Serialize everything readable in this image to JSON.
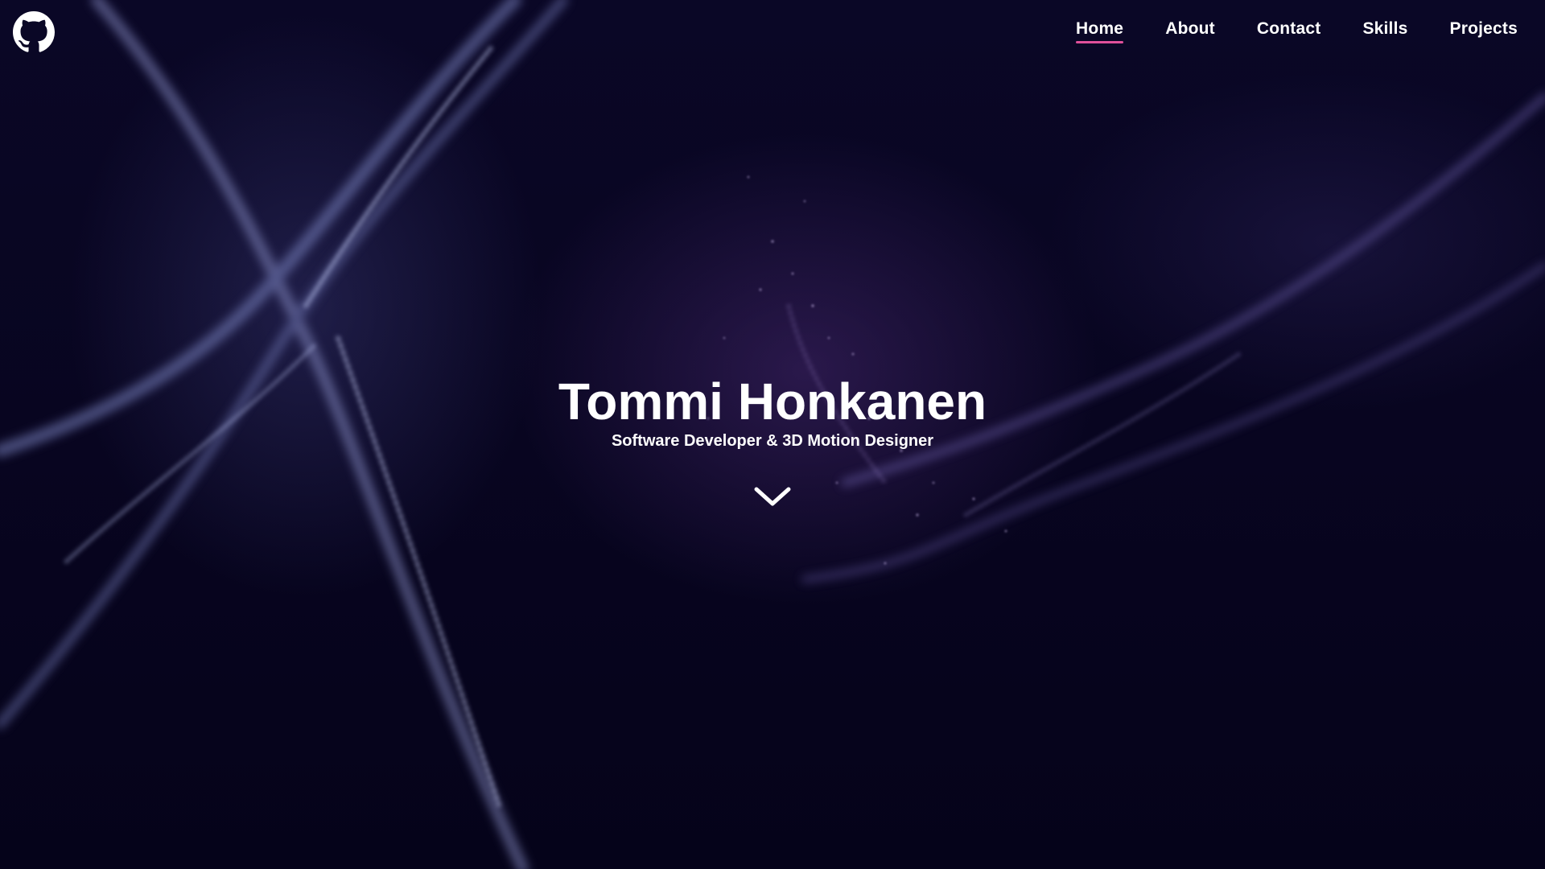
{
  "header": {
    "logo_icon": "github-icon",
    "nav": {
      "items": [
        {
          "label": "Home",
          "active": true
        },
        {
          "label": "About",
          "active": false
        },
        {
          "label": "Contact",
          "active": false
        },
        {
          "label": "Skills",
          "active": false
        },
        {
          "label": "Projects",
          "active": false
        }
      ],
      "active_underline_color": "#e0509a"
    }
  },
  "hero": {
    "title": "Tommi Honkanen",
    "subtitle": "Software Developer & 3D Motion Designer",
    "scroll_icon": "chevron-down-icon"
  },
  "colors": {
    "background": "#07051a",
    "text": "#ffffff",
    "accent": "#e0509a"
  }
}
